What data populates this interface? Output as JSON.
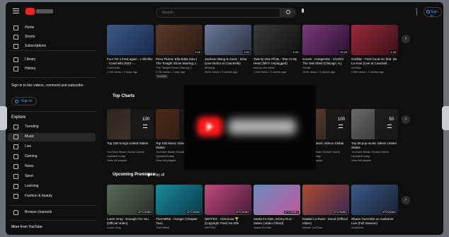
{
  "topbar": {
    "search_placeholder": "Search",
    "signin_label": "Sign in"
  },
  "sidebar": {
    "items": [
      {
        "label": "Home",
        "icon": "home-icon"
      },
      {
        "label": "Shorts",
        "icon": "shorts-icon"
      },
      {
        "label": "Subscriptions",
        "icon": "subscriptions-icon"
      },
      {
        "label": "Library",
        "icon": "library-icon"
      },
      {
        "label": "History",
        "icon": "history-icon"
      }
    ],
    "promo": "Sign in to like videos, comment and subscribe.",
    "signin_label": "Sign in",
    "explore_title": "Explore",
    "explore": [
      {
        "label": "Trending",
        "icon": "trending-icon"
      },
      {
        "label": "Music",
        "icon": "music-icon",
        "active": true
      },
      {
        "label": "Live",
        "icon": "live-icon"
      },
      {
        "label": "Gaming",
        "icon": "gaming-icon"
      },
      {
        "label": "News",
        "icon": "news-icon"
      },
      {
        "label": "Sport",
        "icon": "sport-icon"
      },
      {
        "label": "Learning",
        "icon": "learning-icon"
      },
      {
        "label": "Fashion & beauty",
        "icon": "fashion-icon"
      }
    ],
    "browse_label": "Browse channels",
    "more_title": "More from YouTube"
  },
  "row1": [
    {
      "title": "Four Tet x Fred again.. x Skrillex - Coachella 2023 -...",
      "channel": "Coachella",
      "meta": "2.1M views • 2 days ago",
      "duration": "",
      "colors": [
        "#3a5a8a",
        "#1a2a4a"
      ]
    },
    {
      "title": "Peso Pluma: Ella Baila Sola | The Tonight Show Starring J...",
      "channel": "The Tonight Show Starring J...",
      "meta": "5.7M views • 1 day ago",
      "duration": "4:40",
      "tag": "Subtitles",
      "colors": [
        "#5a3a2a",
        "#2a1a12"
      ]
    },
    {
      "title": "Jackson Wang & Ciara - Slow (Live Debut at Coachella)",
      "channel": "88rising",
      "meta": "462K views • 2 weeks ago",
      "duration": "3:52",
      "colors": [
        "#6a7a9a",
        "#2a3040"
      ]
    },
    {
      "title": "Twenty One Pilots - Tear In My Heart (MTV Unplugged)",
      "channel": "twenty one pilots",
      "meta": "1.9M views • 2 weeks ago",
      "duration": "4:45",
      "colors": [
        "#3a3a3a",
        "#101010"
      ]
    },
    {
      "title": "Goose - Hungersite - 4/14/23 The Salt Shed (Chicago, IL)",
      "channel": "Goose",
      "meta": "154K views • 2 weeks ago",
      "duration": "10:25",
      "colors": [
        "#7a3a7a",
        "#2a1030"
      ]
    },
    {
      "title": "Gorillaz - Feel Good Inc feat. De La Soul (Live at Coachell...",
      "channel": "Gorillaz",
      "meta": "2.8M views • 2 weeks ago",
      "duration": "4:28",
      "colors": [
        "#9a2a3a",
        "#3a1018"
      ]
    }
  ],
  "charts_title": "Top Charts",
  "charts": [
    {
      "title": "Top 100 Songs United States",
      "channel": "YouTube Music Global Charts",
      "meta": "Updated today",
      "link": "View full playlist",
      "count": "100",
      "colors": [
        "#2a2420",
        "#4a3a30"
      ]
    },
    {
      "title": "Top 100 Music Videos United States",
      "channel": "YouTube Music Global Charts",
      "meta": "Updated today",
      "link": "View full playlist",
      "count": "100",
      "colors": [
        "#4a2a1a",
        "#2a1a12"
      ]
    },
    {
      "title": "",
      "channel": "",
      "meta": "",
      "link": "",
      "count": "",
      "colors": [
        "#2a2a2a",
        "#1a1a1a"
      ]
    },
    {
      "title": "",
      "channel": "",
      "meta": "",
      "link": "",
      "count": "",
      "colors": [
        "#2a2a2a",
        "#1a1a1a"
      ]
    },
    {
      "title": "Top 100 Music Videos Global",
      "channel": "YouTube Music Global Charts",
      "meta": "Updated today",
      "link": "View full playlist",
      "count": "100",
      "colors": [
        "#5a4030",
        "#2a1e18"
      ]
    },
    {
      "title": "Top 50 pop music videos United States",
      "channel": "YouTube Music Global Charts",
      "meta": "Updated today",
      "link": "View full playlist",
      "count": "50",
      "colors": [
        "#6a6a6a",
        "#2a2a2a"
      ]
    }
  ],
  "premieres_title": "Upcoming Premieres",
  "play_all": "Play all",
  "premieres": [
    {
      "title": "Loren Gray - Enough For You (Official Video)",
      "channel": "Loren Gray",
      "meta": "",
      "badge": "UPCOMING",
      "colors": [
        "#5a6a5a",
        "#2a3028"
      ]
    },
    {
      "title": "TheFatRat - Hunger (Chapter Two)",
      "channel": "TheFatRat",
      "meta": "",
      "badge": "UPCOMING",
      "colors": [
        "#1a8a9a",
        "#0a3a4a"
      ]
    },
    {
      "title": "NEFFEX - Victorious 🏆 [Copyright Free] No.205",
      "channel": "NEFFEX",
      "meta": "",
      "badge": "UPCOMING",
      "colors": [
        "#c04a7a",
        "#4a1a3a"
      ]
    },
    {
      "title": "Santa Fe Klan, Kenny Ruiz - Sabes (Video Oficial)",
      "channel": "Santa Fe Klan",
      "meta": "",
      "badge": "UPCOMING",
      "colors": [
        "#6a8ac0",
        "#c05a9a"
      ]
    },
    {
      "title": "Natalie La Rose - Mood (Official Video)",
      "channel": "Natalie La Rose",
      "meta": "",
      "badge": "UPCOMING",
      "colors": [
        "#b04a30",
        "#3a2a50"
      ]
    },
    {
      "title": "Shane Guerrette on Audiotree Live (Full Session)",
      "channel": "Audiotree",
      "meta": "",
      "badge": "UPCOMING",
      "colors": [
        "#3a5a8a",
        "#1a2030"
      ]
    }
  ]
}
